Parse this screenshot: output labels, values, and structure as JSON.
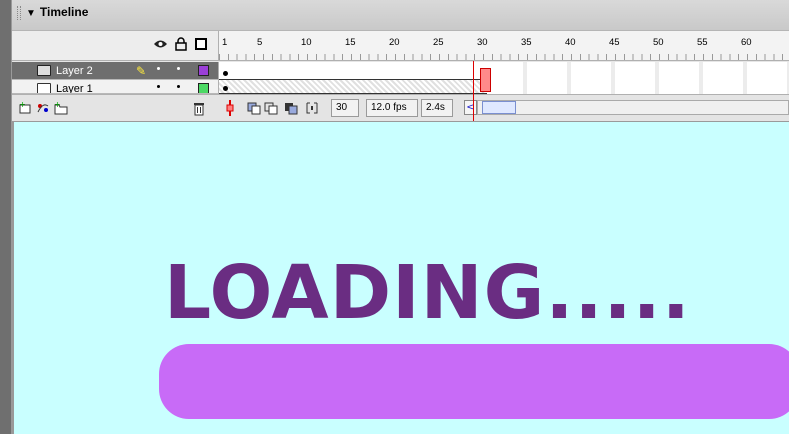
{
  "panel": {
    "title": "Timeline",
    "collapse_icon": "triangle-down-icon"
  },
  "layer_header_icons": [
    "eye-icon",
    "lock-icon",
    "outline-square-icon"
  ],
  "frame_ruler": {
    "ticks": [
      "1",
      "5",
      "10",
      "15",
      "20",
      "25",
      "30",
      "35",
      "40",
      "45",
      "50",
      "55",
      "60"
    ],
    "current_frame": "30"
  },
  "layers": [
    {
      "name": "Layer 2",
      "selected": true,
      "editing": true,
      "color": "#9b3fd8"
    },
    {
      "name": "Layer 1",
      "selected": false,
      "editing": false,
      "color": "#4cd964"
    }
  ],
  "toolbar": {
    "buttons": [
      "insert-layer-icon",
      "add-motion-guide-icon",
      "insert-folder-icon",
      "delete-layer-icon",
      "center-frame-icon",
      "onion-skin-icon",
      "onion-skin-outlines-icon",
      "edit-multiple-frames-icon",
      "modify-onion-markers-icon"
    ],
    "current_frame": "30",
    "frame_rate": "12.0 fps",
    "elapsed_time": "2.4s"
  },
  "stage": {
    "text": "LOADING.....",
    "text_color": "#6a2d82",
    "bar_color": "#c86bf7",
    "background": "#c9ffff"
  }
}
